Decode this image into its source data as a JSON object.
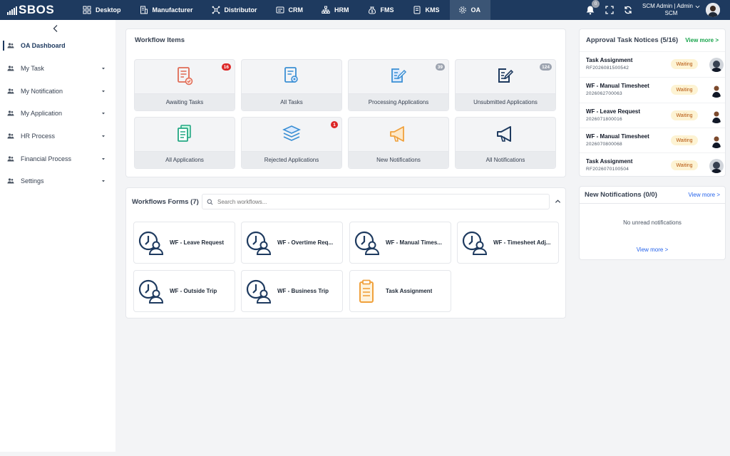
{
  "app": {
    "logo": "SBOS"
  },
  "nav": [
    {
      "label": "Desktop",
      "icon": "desktop-icon"
    },
    {
      "label": "Manufacturer",
      "icon": "building-icon"
    },
    {
      "label": "Distributor",
      "icon": "network-icon"
    },
    {
      "label": "CRM",
      "icon": "crm-icon"
    },
    {
      "label": "HRM",
      "icon": "org-chart-icon"
    },
    {
      "label": "FMS",
      "icon": "money-bag-icon"
    },
    {
      "label": "KMS",
      "icon": "book-icon"
    },
    {
      "label": "OA",
      "icon": "gear-icon"
    }
  ],
  "topbar": {
    "notification_count": "0",
    "user_name": "SCM Admin | Admin",
    "user_org": "SCM"
  },
  "sidebar": {
    "items": [
      {
        "label": "OA Dashboard",
        "active": true,
        "has_caret": false
      },
      {
        "label": "My Task",
        "has_caret": true
      },
      {
        "label": "My Notification",
        "has_caret": true
      },
      {
        "label": "My Application",
        "has_caret": true
      },
      {
        "label": "HR Process",
        "has_caret": true
      },
      {
        "label": "Financial Process",
        "has_caret": true
      },
      {
        "label": "Settings",
        "has_caret": true
      }
    ]
  },
  "workflow_items": {
    "title": "Workflow Items",
    "cards": [
      {
        "label": "Awaiting Tasks",
        "badge": "16",
        "badge_color": "red",
        "icon": "document-check-icon",
        "color": "#e06b55"
      },
      {
        "label": "All Tasks",
        "badge": "",
        "icon": "document-search-icon",
        "color": "#3b8fd4"
      },
      {
        "label": "Processing Applications",
        "badge": "39",
        "badge_color": "gray",
        "icon": "edit-document-icon",
        "color": "#3b8fd4"
      },
      {
        "label": "Unsubmitted Applications",
        "badge": "124",
        "badge_color": "gray",
        "icon": "edit-document-icon",
        "color": "#1e3a5f"
      },
      {
        "label": "All Applications",
        "badge": "",
        "icon": "documents-stack-icon",
        "color": "#22a783"
      },
      {
        "label": "Rejected Applications",
        "badge": "1",
        "badge_color": "red",
        "icon": "layers-icon",
        "color": "#3b8fd4"
      },
      {
        "label": "New Notifications",
        "badge": "",
        "icon": "megaphone-icon",
        "color": "#f0a13c"
      },
      {
        "label": "All Notifications",
        "badge": "",
        "icon": "megaphone-icon",
        "color": "#1e3a5f"
      }
    ]
  },
  "workflow_forms": {
    "title": "Workflows Forms (7)",
    "search_placeholder": "Search workflows...",
    "forms": [
      {
        "label": "WF - Leave Request",
        "icon": "user-clock-icon"
      },
      {
        "label": "WF - Overtime Req...",
        "icon": "user-clock-icon"
      },
      {
        "label": "WF - Manual Times...",
        "icon": "user-clock-icon"
      },
      {
        "label": "WF - Timesheet Adj...",
        "icon": "user-clock-icon"
      },
      {
        "label": "WF - Outside Trip",
        "icon": "user-clock-icon"
      },
      {
        "label": "WF - Business Trip",
        "icon": "user-clock-icon"
      },
      {
        "label": "Task Assignment",
        "icon": "clipboard-icon"
      }
    ]
  },
  "approval_notices": {
    "title": "Approval Task Notices (5/16)",
    "view_more": "View more >",
    "rows": [
      {
        "title": "Task Assignment",
        "id": "RF2026081500542",
        "status": "Waiting"
      },
      {
        "title": "WF - Manual Timesheet",
        "id": "2026062700063",
        "status": "Waiting"
      },
      {
        "title": "WF - Leave Request",
        "id": "2026071800016",
        "status": "Waiting"
      },
      {
        "title": "WF - Manual Timesheet",
        "id": "2026070800068",
        "status": "Waiting"
      },
      {
        "title": "Task Assignment",
        "id": "RF2026070100504",
        "status": "Waiting"
      }
    ]
  },
  "new_notifications": {
    "title": "New Notifications (0/0)",
    "view_more_top": "View more >",
    "empty_text": "No unread notifications",
    "view_more_bottom": "View more >"
  }
}
